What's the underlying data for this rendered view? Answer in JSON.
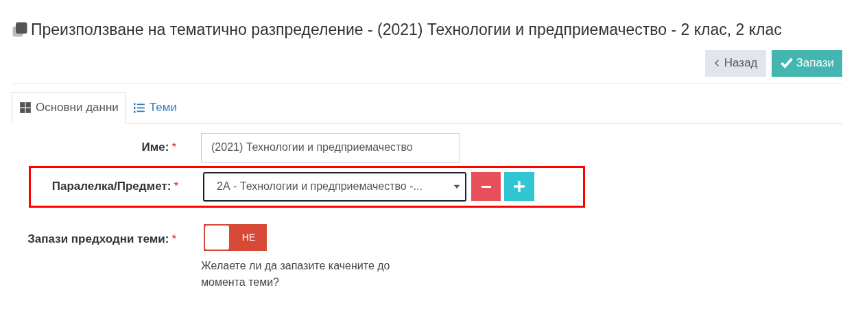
{
  "page": {
    "title": "Преизползване на тематично разпределение - (2021) Технологии и предприемачество - 2 клас, 2 клас"
  },
  "buttons": [
    {
      "kind": "back",
      "label": "Назад"
    },
    {
      "kind": "save",
      "label": "Запази"
    }
  ],
  "tabs": [
    {
      "kind": "grid",
      "label": "Основни данни",
      "selected": true
    },
    {
      "kind": "list",
      "label": "Теми",
      "selected": false
    }
  ],
  "form": {
    "name": {
      "label": "Име:",
      "required": "*",
      "value": "(2021) Технологии и предприемачество"
    },
    "class_subject": {
      "label": "Паралелка/Предмет:",
      "required": "*",
      "value": "2А - Технологии и предприемачество -...",
      "highlighted": true
    },
    "keep_topics": {
      "label": "Запази предходни теми:",
      "required": "*",
      "on": false,
      "toggle_text": "НЕ",
      "help": "Желаете ли да запазите качените до момента теми?"
    }
  }
}
